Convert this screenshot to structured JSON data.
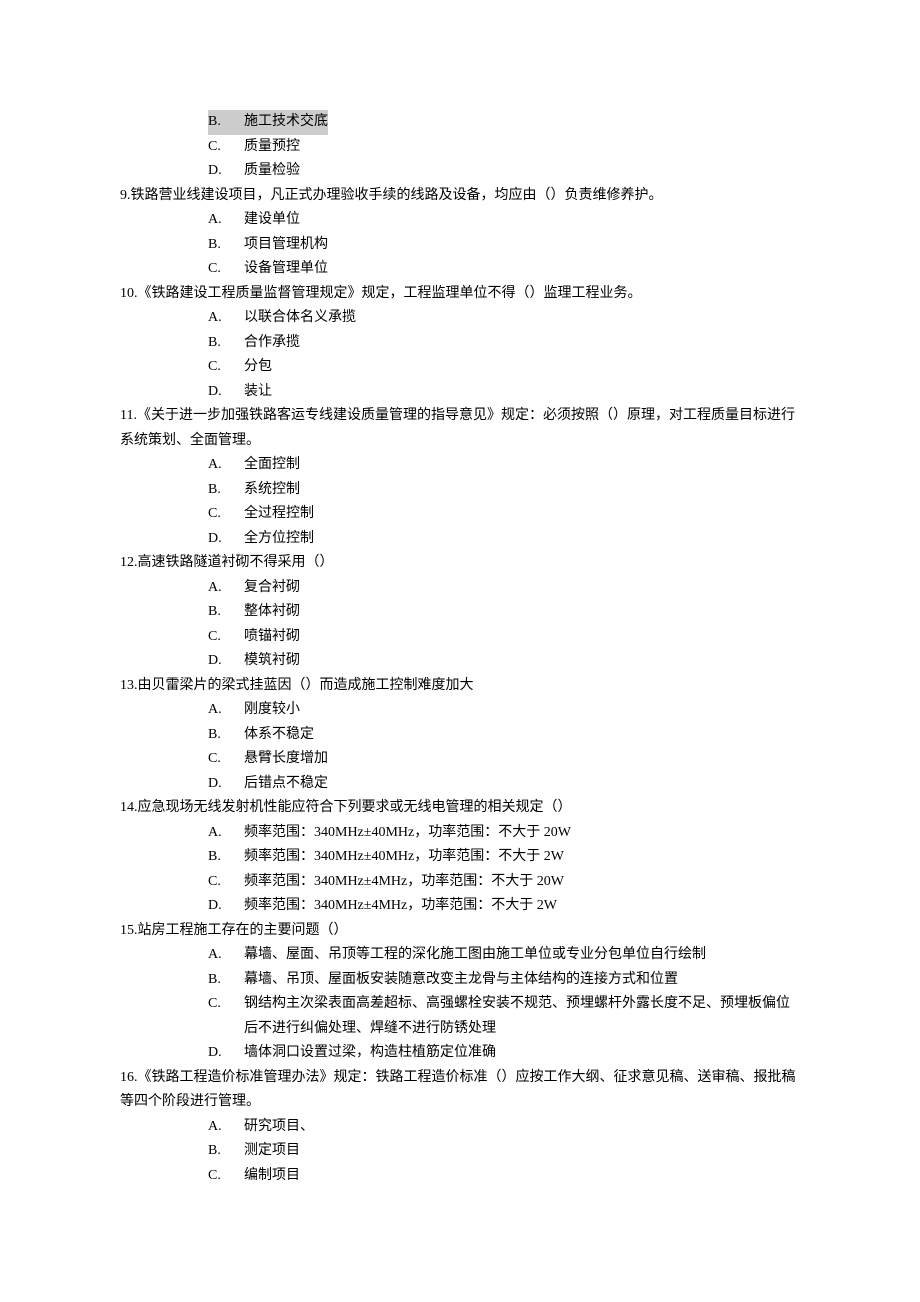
{
  "questions": [
    {
      "number": "",
      "text": "",
      "options": [
        {
          "letter": "B.",
          "text": "施工技术交底",
          "highlight": true
        },
        {
          "letter": "C.",
          "text": "质量预控",
          "highlight": false
        },
        {
          "letter": "D.",
          "text": "质量检验",
          "highlight": false
        }
      ]
    },
    {
      "number": "9.",
      "text": "铁路营业线建设项目，凡正式办理验收手续的线路及设备，均应由（）负责维修养护。",
      "options": [
        {
          "letter": "A.",
          "text": "建设单位",
          "highlight": false
        },
        {
          "letter": "B.",
          "text": "项目管理机构",
          "highlight": false
        },
        {
          "letter": "C.",
          "text": "设备管理单位",
          "highlight": false
        }
      ]
    },
    {
      "number": "10.",
      "text": "《铁路建设工程质量监督管理规定》规定，工程监理单位不得（）监理工程业务。",
      "options": [
        {
          "letter": "A.",
          "text": "以联合体名义承揽",
          "highlight": false
        },
        {
          "letter": "B.",
          "text": "合作承揽",
          "highlight": false
        },
        {
          "letter": "C.",
          "text": "分包",
          "highlight": false
        },
        {
          "letter": "D.",
          "text": "装让",
          "highlight": false
        }
      ]
    },
    {
      "number": "11.",
      "text": "《关于进一步加强铁路客运专线建设质量管理的指导意见》规定：必须按照（）原理，对工程质量目标进行系统策划、全面管理。",
      "options": [
        {
          "letter": "A.",
          "text": "全面控制",
          "highlight": false
        },
        {
          "letter": "B.",
          "text": "系统控制",
          "highlight": false
        },
        {
          "letter": "C.",
          "text": "全过程控制",
          "highlight": false
        },
        {
          "letter": "D.",
          "text": "全方位控制",
          "highlight": false
        }
      ]
    },
    {
      "number": "12.",
      "text": "高速铁路隧道衬砌不得采用（）",
      "options": [
        {
          "letter": "A.",
          "text": "复合衬砌",
          "highlight": false
        },
        {
          "letter": "B.",
          "text": "整体衬砌",
          "highlight": false
        },
        {
          "letter": "C.",
          "text": "喷锚衬砌",
          "highlight": false
        },
        {
          "letter": "D.",
          "text": "模筑衬砌",
          "highlight": false
        }
      ]
    },
    {
      "number": "13.",
      "text": "由贝雷梁片的梁式挂蓝因（）而造成施工控制难度加大",
      "options": [
        {
          "letter": "A.",
          "text": "刚度较小",
          "highlight": false
        },
        {
          "letter": "B.",
          "text": "体系不稳定",
          "highlight": false
        },
        {
          "letter": "C.",
          "text": "悬臂长度增加",
          "highlight": false
        },
        {
          "letter": "D.",
          "text": "后错点不稳定",
          "highlight": false
        }
      ]
    },
    {
      "number": "14.",
      "text": "应急现场无线发射机性能应符合下列要求或无线电管理的相关规定（）",
      "options": [
        {
          "letter": "A.",
          "text": "频率范围：340MHz±40MHz，功率范围：不大于 20W",
          "highlight": false
        },
        {
          "letter": "B.",
          "text": "频率范围：340MHz±40MHz，功率范围：不大于 2W",
          "highlight": false
        },
        {
          "letter": "C.",
          "text": "频率范围：340MHz±4MHz，功率范围：不大于 20W",
          "highlight": false
        },
        {
          "letter": "D.",
          "text": "频率范围：340MHz±4MHz，功率范围：不大于 2W",
          "highlight": false
        }
      ]
    },
    {
      "number": "15.",
      "text": "站房工程施工存在的主要问题（）",
      "options": [
        {
          "letter": "A.",
          "text": "幕墙、屋面、吊顶等工程的深化施工图由施工单位或专业分包单位自行绘制",
          "highlight": false
        },
        {
          "letter": "B.",
          "text": "幕墙、吊顶、屋面板安装随意改变主龙骨与主体结构的连接方式和位置",
          "highlight": false
        },
        {
          "letter": "C.",
          "text": "钢结构主次梁表面高差超标、高强螺栓安装不规范、预埋螺杆外露长度不足、预埋板偏位后不进行纠偏处理、焊缝不进行防锈处理",
          "highlight": false
        },
        {
          "letter": "D.",
          "text": "墙体洞口设置过梁，构造柱植筋定位准确",
          "highlight": false
        }
      ]
    },
    {
      "number": "16.",
      "text": "《铁路工程造价标准管理办法》规定：铁路工程造价标准（）应按工作大纲、征求意见稿、送审稿、报批稿等四个阶段进行管理。",
      "options": [
        {
          "letter": "A.",
          "text": "研究项目、",
          "highlight": false
        },
        {
          "letter": "B.",
          "text": "测定项目",
          "highlight": false
        },
        {
          "letter": "C.",
          "text": "编制项目",
          "highlight": false
        }
      ]
    }
  ]
}
